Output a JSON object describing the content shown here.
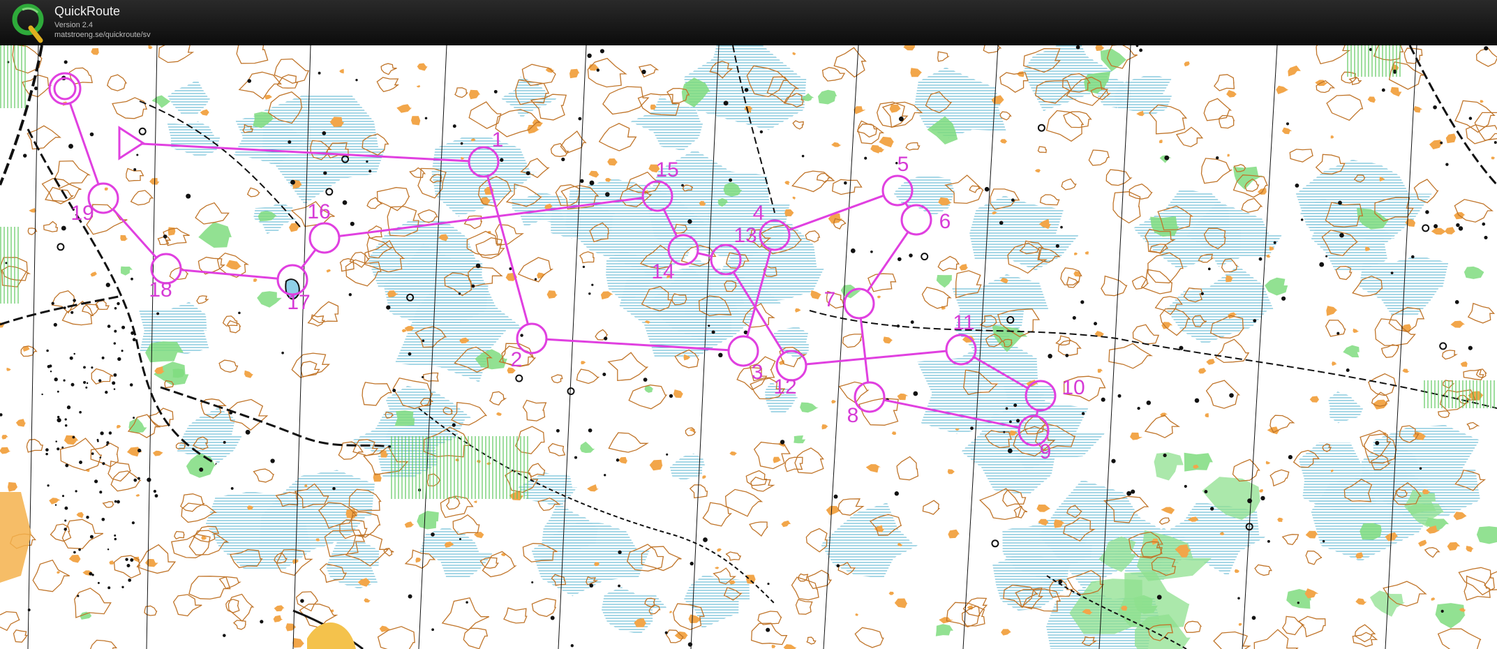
{
  "app": {
    "title": "QuickRoute",
    "version": "Version 2.4",
    "url": "matstroeng.se/quickroute/sv"
  },
  "colors": {
    "course": "#e040e0",
    "label": "#d63bd6",
    "contour": "#c0752a",
    "marsh": "#3aa6c8",
    "rock": "#f2a64a",
    "vegetation": "#6ed26e"
  },
  "map": {
    "controls": [
      "1",
      "2",
      "3",
      "4",
      "5",
      "6",
      "7",
      "8",
      "9",
      "10",
      "11",
      "12",
      "13",
      "14",
      "15",
      "16",
      "17",
      "18",
      "19"
    ]
  }
}
